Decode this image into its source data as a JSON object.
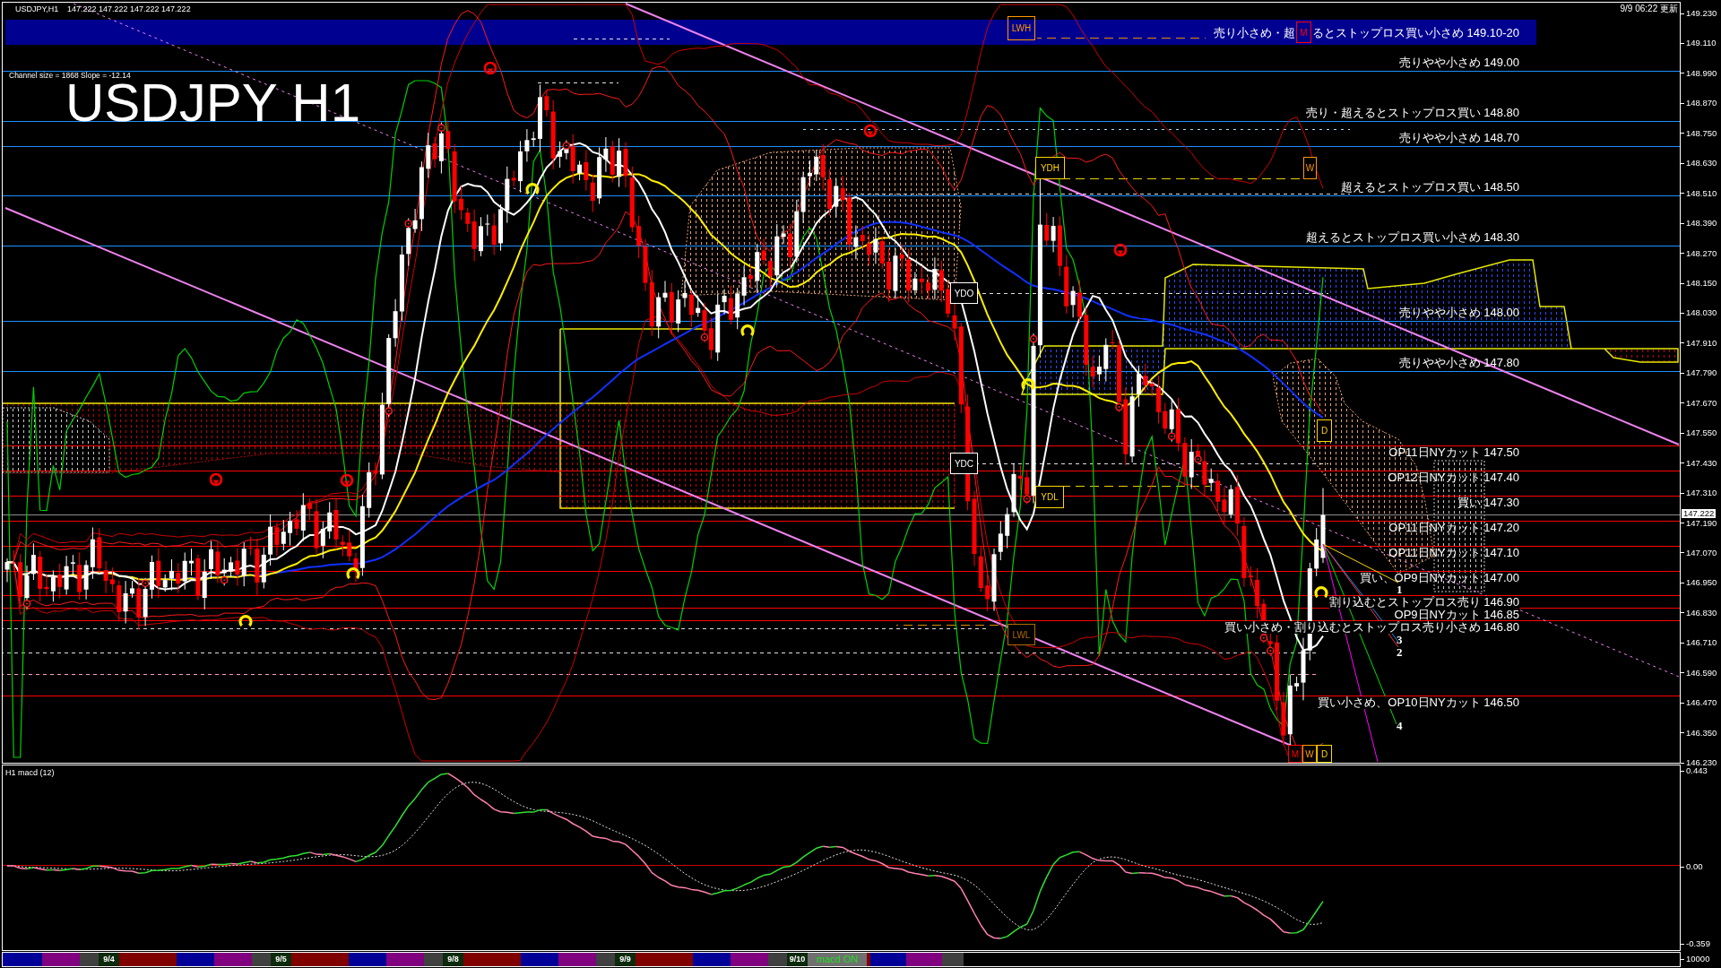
{
  "header": {
    "symbol": "USDJPY,H1",
    "prices": "147.222 147.222 147.222 147.222",
    "updated": "9/9 06:22 更新"
  },
  "channel_info": "Channel size = 1868 Slope = -12.14",
  "chart_title": "USDJPY H1",
  "zone_band": {
    "label_start": "売り小さめ・超",
    "marker": {
      "text": "M",
      "color": "#ff0000"
    },
    "label_end": "るとストップロス買い小さめ 149.10-20"
  },
  "levels": [
    {
      "label": "売りやや小さめ 149.00",
      "color": "#1e90ff"
    },
    {
      "label": "売り・超えるとストップロス買い 148.80",
      "color": "#1e90ff"
    },
    {
      "label": "売りやや小さめ 148.70",
      "color": "#1e90ff"
    },
    {
      "label": "超えるとストップロス買い 148.50",
      "color": "#1e90ff"
    },
    {
      "label": "超えるとストップロス買い小さめ 148.30",
      "color": "#1e90ff"
    },
    {
      "label": "売りやや小さめ 148.00",
      "color": "#1e90ff"
    },
    {
      "label": "売りやや小さめ 147.80",
      "color": "#1e90ff"
    },
    {
      "label": "OP11日NYカット 147.50",
      "color": "#ff0000"
    },
    {
      "label": "OP12日NYカット 147.40",
      "color": "#ff0000"
    },
    {
      "label": "買い 147.30",
      "color": "#ff0000"
    },
    {
      "label": "OP11日NYカット 147.20",
      "color": "#ff0000"
    },
    {
      "label": "OP11日NYカット 147.10",
      "color": "#ff0000"
    },
    {
      "label": "買い、OP9日NYカット 147.00",
      "color": "#ff0000"
    },
    {
      "label": "割り込むとストップロス売り 146.90",
      "color": "#ff0000"
    },
    {
      "label": "OP9日NYカット 146.85",
      "color": "#ff0000"
    },
    {
      "label": "買い小さめ・割り込むとストップロス売り小さめ 146.80",
      "color": "#ff0000"
    },
    {
      "label": "買い小さめ、OP10日NYカット 146.50",
      "color": "#ff0000"
    }
  ],
  "markers": [
    {
      "text": "LWH",
      "color": "#ff9900"
    },
    {
      "text": "YDH",
      "color": "#ffd700"
    },
    {
      "text": "W",
      "color": "#ff9900"
    },
    {
      "text": "YDO",
      "color": "#ffffff"
    },
    {
      "text": "YDC",
      "color": "#ffffff"
    },
    {
      "text": "YDL",
      "color": "#ffd700"
    },
    {
      "text": "D",
      "color": "#ffd700"
    },
    {
      "text": "LWL",
      "color": "#b36b00"
    },
    {
      "text": "M",
      "color": "#ff0000"
    },
    {
      "text": "W",
      "color": "#ff9900"
    },
    {
      "text": "D",
      "color": "#ffd700"
    }
  ],
  "projection_labels": [
    "1",
    "3",
    "2",
    "4"
  ],
  "price_axis": {
    "ticks": [
      "149.230",
      "149.110",
      "148.990",
      "148.870",
      "148.750",
      "148.630",
      "148.510",
      "148.390",
      "148.270",
      "148.150",
      "148.030",
      "147.910",
      "147.790",
      "147.670",
      "147.550",
      "147.430",
      "147.310",
      "147.190",
      "147.070",
      "146.950",
      "146.830",
      "146.710",
      "146.590",
      "146.470",
      "146.350",
      "146.230"
    ],
    "current_price": "147.222"
  },
  "macd": {
    "title": "H1 macd (12)",
    "axis": [
      "0.443",
      "0.00",
      "-0.359"
    ]
  },
  "session_strip": {
    "dates": [
      "9/4",
      "9/5",
      "9/8",
      "9/9",
      "9/10"
    ],
    "status_label": "macd ON",
    "axis_label": "10000"
  }
}
